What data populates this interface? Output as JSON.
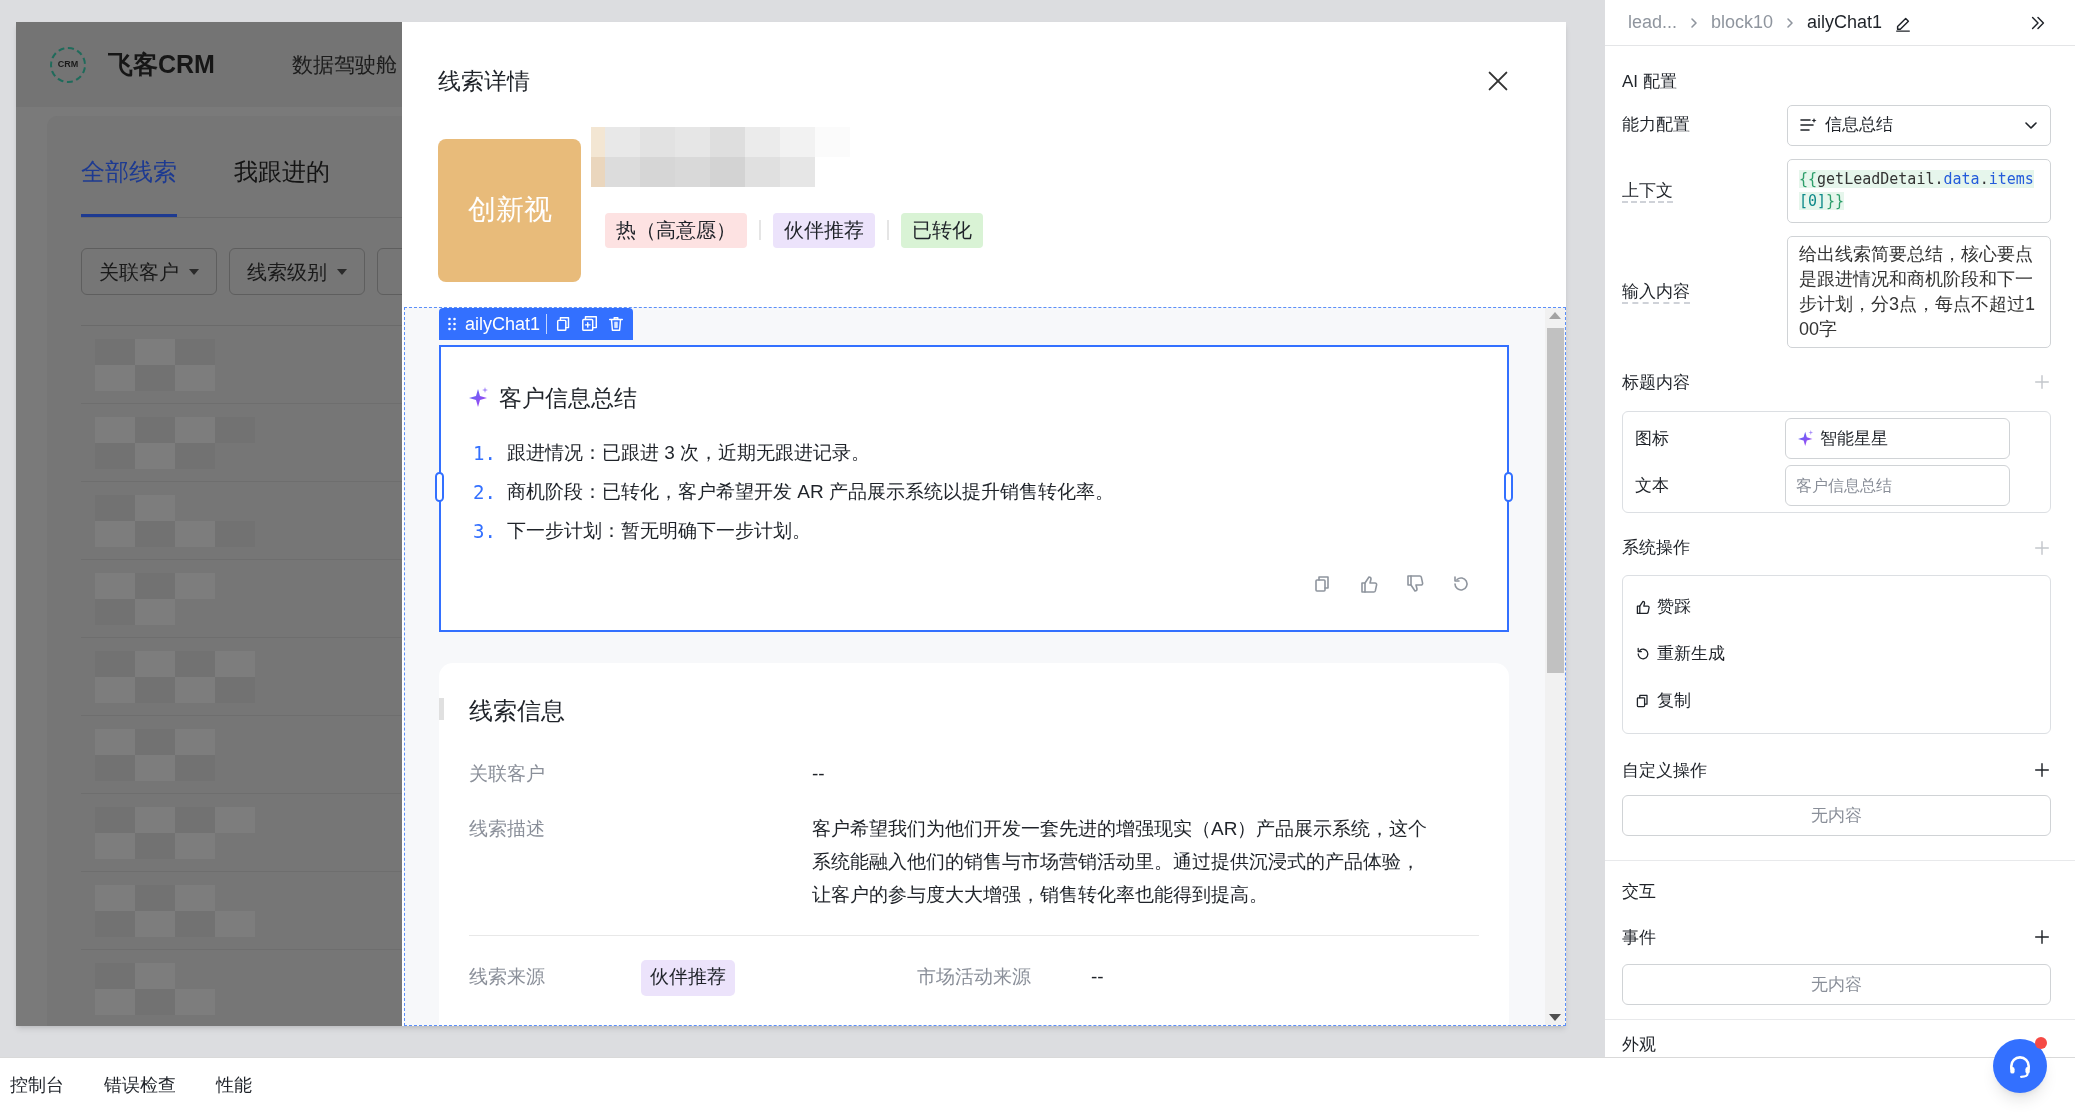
{
  "app": {
    "logo_text": "CRM",
    "name": "飞客CRM",
    "nav": [
      {
        "label": "数据驾驶舱"
      }
    ],
    "tabs": [
      {
        "label": "全部线索",
        "selected": true
      },
      {
        "label": "我跟进的",
        "selected": false
      }
    ],
    "filters": [
      {
        "label": "关联客户"
      },
      {
        "label": "线索级别"
      }
    ]
  },
  "modal": {
    "title": "线索详情",
    "avatar_text": "创新视",
    "tags": [
      {
        "label": "热（高意愿）",
        "color": "#fde2e2"
      },
      {
        "label": "伙伴推荐",
        "color": "#ece3fb"
      },
      {
        "label": "已转化",
        "color": "#d9f3d5"
      }
    ]
  },
  "component_toolbar": {
    "label": "ailyChat1"
  },
  "chat_card": {
    "title": "客户信息总结",
    "items": [
      {
        "number": "1.",
        "text": "跟进情况：已跟进 3 次，近期无跟进记录。"
      },
      {
        "number": "2.",
        "text": "商机阶段：已转化，客户希望开发 AR 产品展示系统以提升销售转化率。"
      },
      {
        "number": "3.",
        "text": "下一步计划：暂无明确下一步计划。"
      }
    ]
  },
  "lead_info": {
    "title": "线索信息",
    "fields": [
      {
        "label": "关联客户",
        "value": "--"
      },
      {
        "label": "线索描述",
        "value": "客户希望我们为他们开发一套先进的增强现实（AR）产品展示系统，这个系统能融入他们的销售与市场营销活动里。通过提供沉浸式的产品体验，让客户的参与度大大增强，销售转化率也能得到提高。"
      }
    ],
    "source_row": [
      {
        "label": "线索来源",
        "value": "伙伴推荐",
        "kind": "tag"
      },
      {
        "label": "市场活动来源",
        "value": "--",
        "kind": "text"
      }
    ]
  },
  "breadcrumb": [
    {
      "label": "lead...",
      "selected": false
    },
    {
      "label": "block10",
      "selected": false
    },
    {
      "label": "ailyChat1",
      "selected": true
    }
  ],
  "ai_config": {
    "title": "AI 配置",
    "ability": {
      "label": "能力配置",
      "value": "信息总结"
    },
    "context": {
      "label": "上下文",
      "tokens": [
        {
          "text": "{{",
          "kind": "brace"
        },
        {
          "text": "getLeadDetail",
          "kind": "identifier"
        },
        {
          "text": ".",
          "kind": "punct"
        },
        {
          "text": "data",
          "kind": "property"
        },
        {
          "text": ".",
          "kind": "punct"
        },
        {
          "text": "items",
          "kind": "property"
        },
        {
          "text": "[0]",
          "kind": "index"
        },
        {
          "text": "}}",
          "kind": "brace"
        }
      ]
    },
    "input": {
      "label": "输入内容",
      "value": "给出线索简要总结，核心要点是跟进情况和商机阶段和下一步计划，分3点，每点不超过100字"
    }
  },
  "title_content": {
    "label": "标题内容",
    "add_enabled": false,
    "rows": [
      {
        "label": "图标",
        "value": "智能星星",
        "kind": "icon-select"
      },
      {
        "label": "文本",
        "placeholder": "客户信息总结",
        "kind": "input"
      }
    ]
  },
  "system_actions": {
    "label": "系统操作",
    "add_enabled": false,
    "items": [
      {
        "label": "赞踩",
        "kind": "like"
      },
      {
        "label": "重新生成",
        "kind": "regenerate"
      },
      {
        "label": "复制",
        "kind": "copy"
      }
    ]
  },
  "custom_actions": {
    "label": "自定义操作",
    "add_enabled": true,
    "empty_text": "无内容"
  },
  "interaction": {
    "title": "交互",
    "events": {
      "label": "事件",
      "add_enabled": true,
      "empty_text": "无内容"
    }
  },
  "appearance": {
    "title": "外观"
  },
  "bottom_tabs": [
    {
      "label": "控制台"
    },
    {
      "label": "错误检查"
    },
    {
      "label": "性能"
    }
  ],
  "help_button": {
    "notification": true
  }
}
